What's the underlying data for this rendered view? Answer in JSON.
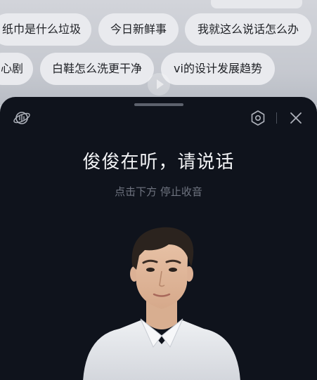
{
  "suggestions": {
    "row1": [
      {
        "label": "纸巾是什么垃圾"
      },
      {
        "label": "今日新鲜事"
      },
      {
        "label": "我就这么说话怎么办"
      }
    ],
    "row2": [
      {
        "label": "心剧"
      },
      {
        "label": "白鞋怎么洗更干净"
      },
      {
        "label": "vi的设计发展趋势"
      }
    ]
  },
  "voice_panel": {
    "title": "俊俊在听，请说话",
    "subtitle": "点击下方 停止收音"
  },
  "colors": {
    "panel_bg": "#0f131c",
    "chip_bg": "#e9eaee",
    "title_text": "#f2f3f5",
    "subtitle_text": "#6f7480"
  },
  "icons": {
    "top_left": "planet-voice-icon",
    "settings": "hexagon-settings-icon",
    "close": "close-icon"
  }
}
